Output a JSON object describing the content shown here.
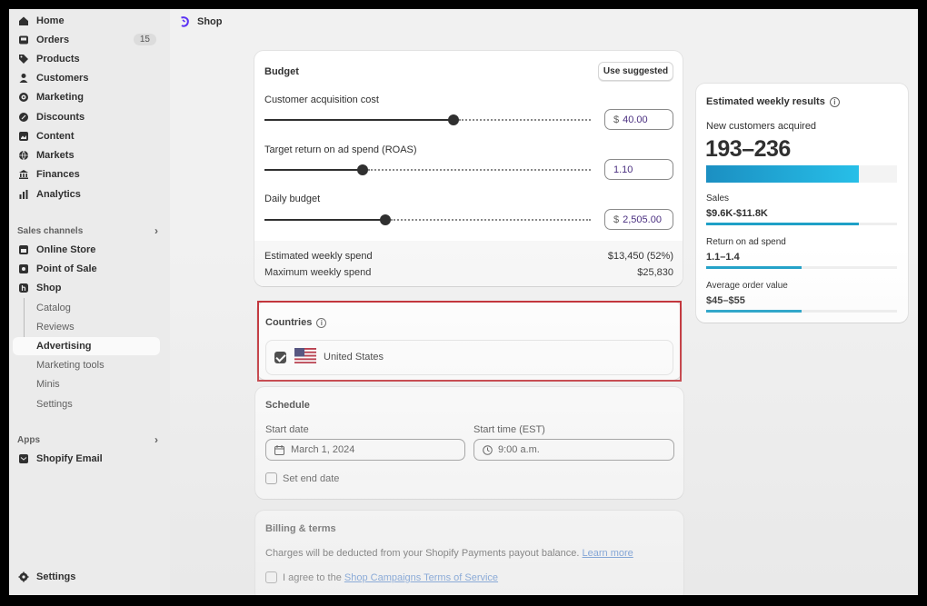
{
  "sidebar": {
    "items": [
      {
        "label": "Home",
        "icon": "home-icon"
      },
      {
        "label": "Orders",
        "icon": "orders-icon",
        "badge": "15"
      },
      {
        "label": "Products",
        "icon": "tag-icon"
      },
      {
        "label": "Customers",
        "icon": "person-icon"
      },
      {
        "label": "Marketing",
        "icon": "target-icon"
      },
      {
        "label": "Discounts",
        "icon": "discount-icon"
      },
      {
        "label": "Content",
        "icon": "content-icon"
      },
      {
        "label": "Markets",
        "icon": "globe-icon"
      },
      {
        "label": "Finances",
        "icon": "bank-icon"
      },
      {
        "label": "Analytics",
        "icon": "chart-icon"
      }
    ],
    "sales_channels_label": "Sales channels",
    "channels": [
      {
        "label": "Online Store",
        "icon": "store-icon"
      },
      {
        "label": "Point of Sale",
        "icon": "pos-icon"
      },
      {
        "label": "Shop",
        "icon": "shop-icon"
      }
    ],
    "shop_subitems": [
      "Catalog",
      "Reviews",
      "Advertising",
      "Marketing tools",
      "Minis",
      "Settings"
    ],
    "apps_label": "Apps",
    "apps": [
      {
        "label": "Shopify Email",
        "icon": "email-icon"
      }
    ],
    "settings_label": "Settings"
  },
  "topbar": {
    "title": "Shop"
  },
  "budget": {
    "title": "Budget",
    "use_suggested": "Use suggested",
    "cac_label": "Customer acquisition cost",
    "cac_prefix": "$",
    "cac_value": "40.00",
    "cac_level": 0.58,
    "roas_label": "Target return on ad spend (ROAS)",
    "roas_value": "1.10",
    "roas_level": 0.3,
    "daily_label": "Daily budget",
    "daily_prefix": "$",
    "daily_value": "2,505.00",
    "daily_level": 0.37,
    "est_weekly_label": "Estimated weekly spend",
    "est_weekly_value": "$13,450 (52%)",
    "max_weekly_label": "Maximum weekly spend",
    "max_weekly_value": "$25,830"
  },
  "countries": {
    "title": "Countries",
    "items": [
      {
        "name": "United States",
        "checked": true
      }
    ]
  },
  "schedule": {
    "title": "Schedule",
    "start_date_label": "Start date",
    "start_date_value": "March 1, 2024",
    "start_time_label": "Start time (EST)",
    "start_time_value": "9:00 a.m.",
    "end_date_label": "Set end date"
  },
  "billing": {
    "title": "Billing & terms",
    "charges_text": "Charges will be deducted from your Shopify Payments payout balance.",
    "learn_more": "Learn more",
    "agree_text": "I agree to the",
    "terms_link": "Shop Campaigns Terms of Service"
  },
  "results": {
    "title": "Estimated weekly results",
    "customers_label": "New customers acquired",
    "customers_value": "193–236",
    "customers_level": 0.8,
    "metrics": [
      {
        "label": "Sales",
        "value": "$9.6K-$11.8K",
        "level": 0.8
      },
      {
        "label": "Return on ad spend",
        "value": "1.1–1.4",
        "level": 0.5
      },
      {
        "label": "Average order value",
        "value": "$45–$55",
        "level": 0.5
      }
    ]
  },
  "colors": {
    "accent": "#1ea0c7",
    "highlight": "#c0262d",
    "link": "#2c6ecb"
  }
}
